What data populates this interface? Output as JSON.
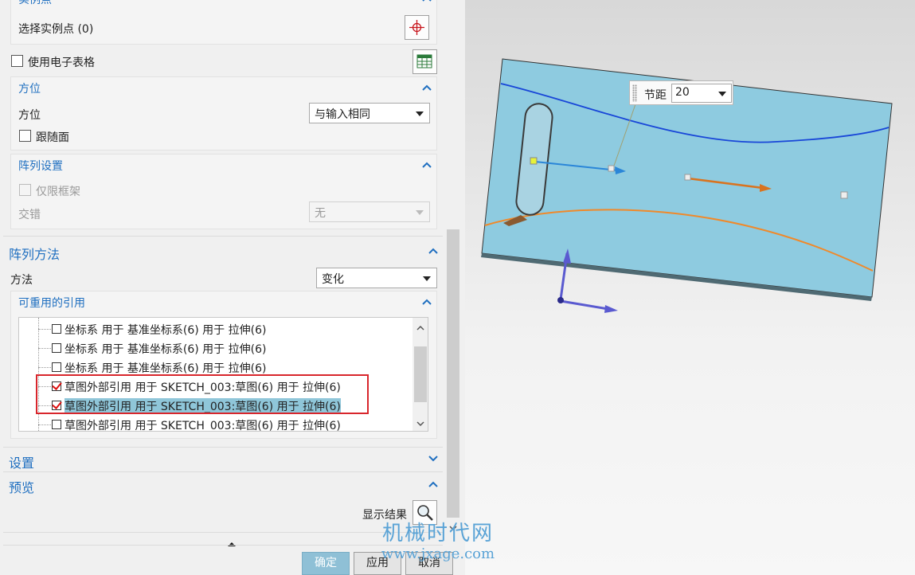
{
  "instance_points": {
    "section_title": "实例点",
    "select_label": "选择实例点 (0)"
  },
  "spreadsheet": {
    "label": "使用电子表格",
    "checked": false
  },
  "orientation": {
    "title": "方位",
    "label": "方位",
    "value": "与输入相同",
    "follow_face_label": "跟随面"
  },
  "array_settings": {
    "title": "阵列设置",
    "frame_only_label": "仅限框架",
    "stagger_label": "交错",
    "stagger_value": "无"
  },
  "array_method": {
    "title": "阵列方法",
    "method_label": "方法",
    "method_value": "变化"
  },
  "reusable_refs": {
    "title": "可重用的引用",
    "items": [
      {
        "text": "坐标系 用于 基准坐标系(6) 用于 拉伸(6)",
        "checked": false,
        "selected": false
      },
      {
        "text": "坐标系 用于 基准坐标系(6) 用于 拉伸(6)",
        "checked": false,
        "selected": false
      },
      {
        "text": "坐标系 用于 基准坐标系(6) 用于 拉伸(6)",
        "checked": false,
        "selected": false
      },
      {
        "text": "草图外部引用 用于 SKETCH_003:草图(6) 用于 拉伸(6)",
        "checked": true,
        "selected": false
      },
      {
        "text": "草图外部引用 用于 SKETCH_003:草图(6) 用于 拉伸(6)",
        "checked": true,
        "selected": true
      },
      {
        "text": "草图外部引用 用于 SKETCH_003:草图(6) 用于 拉伸(6)",
        "checked": false,
        "selected": false
      }
    ]
  },
  "settings": {
    "title": "设置"
  },
  "preview": {
    "title": "预览",
    "show_result_label": "显示结果"
  },
  "buttons": {
    "ok": "确定",
    "apply": "应用",
    "cancel": "取消"
  },
  "viewport": {
    "pitch_label": "节距",
    "pitch_value": "20"
  },
  "watermark": {
    "line1": "机械时代网",
    "line2": "www.jxage.com"
  },
  "colors": {
    "accent": "#1f6fc0",
    "highlight": "#8fc6d9",
    "red_box": "#d8262c",
    "plate": "#8ecbe0",
    "blue_curve": "#1846d8",
    "orange_curve": "#f0892a"
  }
}
